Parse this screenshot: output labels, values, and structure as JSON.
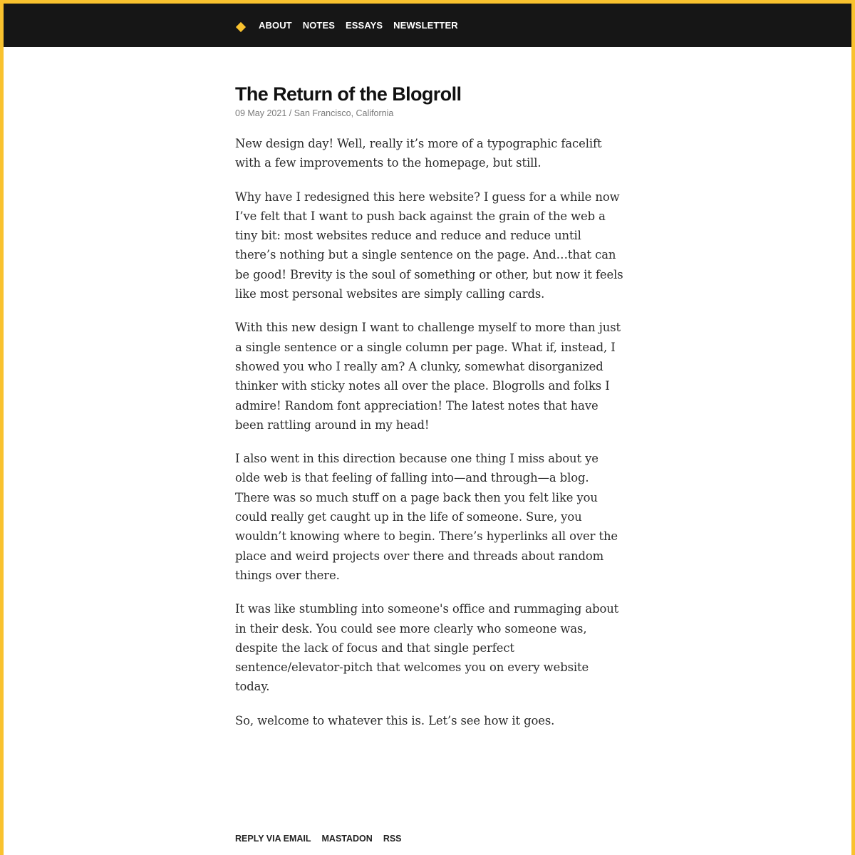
{
  "nav": {
    "logo_icon": "diamond-logo-icon",
    "accent_color": "#f9c22e",
    "items": [
      {
        "label": "ABOUT"
      },
      {
        "label": "NOTES"
      },
      {
        "label": "ESSAYS"
      },
      {
        "label": "NEWSLETTER"
      }
    ]
  },
  "article": {
    "title": "The Return of the Blogroll",
    "meta": "09 May 2021 / San Francisco, California",
    "paragraphs": [
      "New design day! Well, really it’s more of a typographic facelift with a few improvements to the homepage, but still.",
      "Why have I redesigned this here website? I guess for a while now I’ve felt that I want to push back against the grain of the web a tiny bit: most websites reduce and reduce and reduce until there’s nothing but a single sentence on the page. And…that can be good! Brevity is the soul of something or other, but now it feels like most personal websites are simply calling cards.",
      "With this new design I want to challenge myself to more than just a single sentence or a single column per page. What if, instead, I showed you who I really am? A clunky, somewhat disorganized thinker with sticky notes all over the place. Blogrolls and folks I admire! Random font appreciation! The latest notes that have been rattling around in my head!",
      "I also went in this direction because one thing I miss about ye olde web is that feeling of falling into—and through—a blog. There was so much stuff on a page back then you felt like you could really get caught up in the life of someone. Sure, you wouldn’t knowing where to begin. There’s hyperlinks all over the place and weird projects over there and threads about random things over there.",
      "It was like stumbling into someone's office and rummaging about in their desk. You could see more clearly who someone was, despite the lack of focus and that single perfect sentence/elevator-pitch that welcomes you on every website today.",
      "So, welcome to whatever this is. Let’s see how it goes."
    ]
  },
  "footer": {
    "links": [
      {
        "label": "REPLY VIA EMAIL"
      },
      {
        "label": "MASTADON"
      },
      {
        "label": "RSS"
      }
    ]
  }
}
